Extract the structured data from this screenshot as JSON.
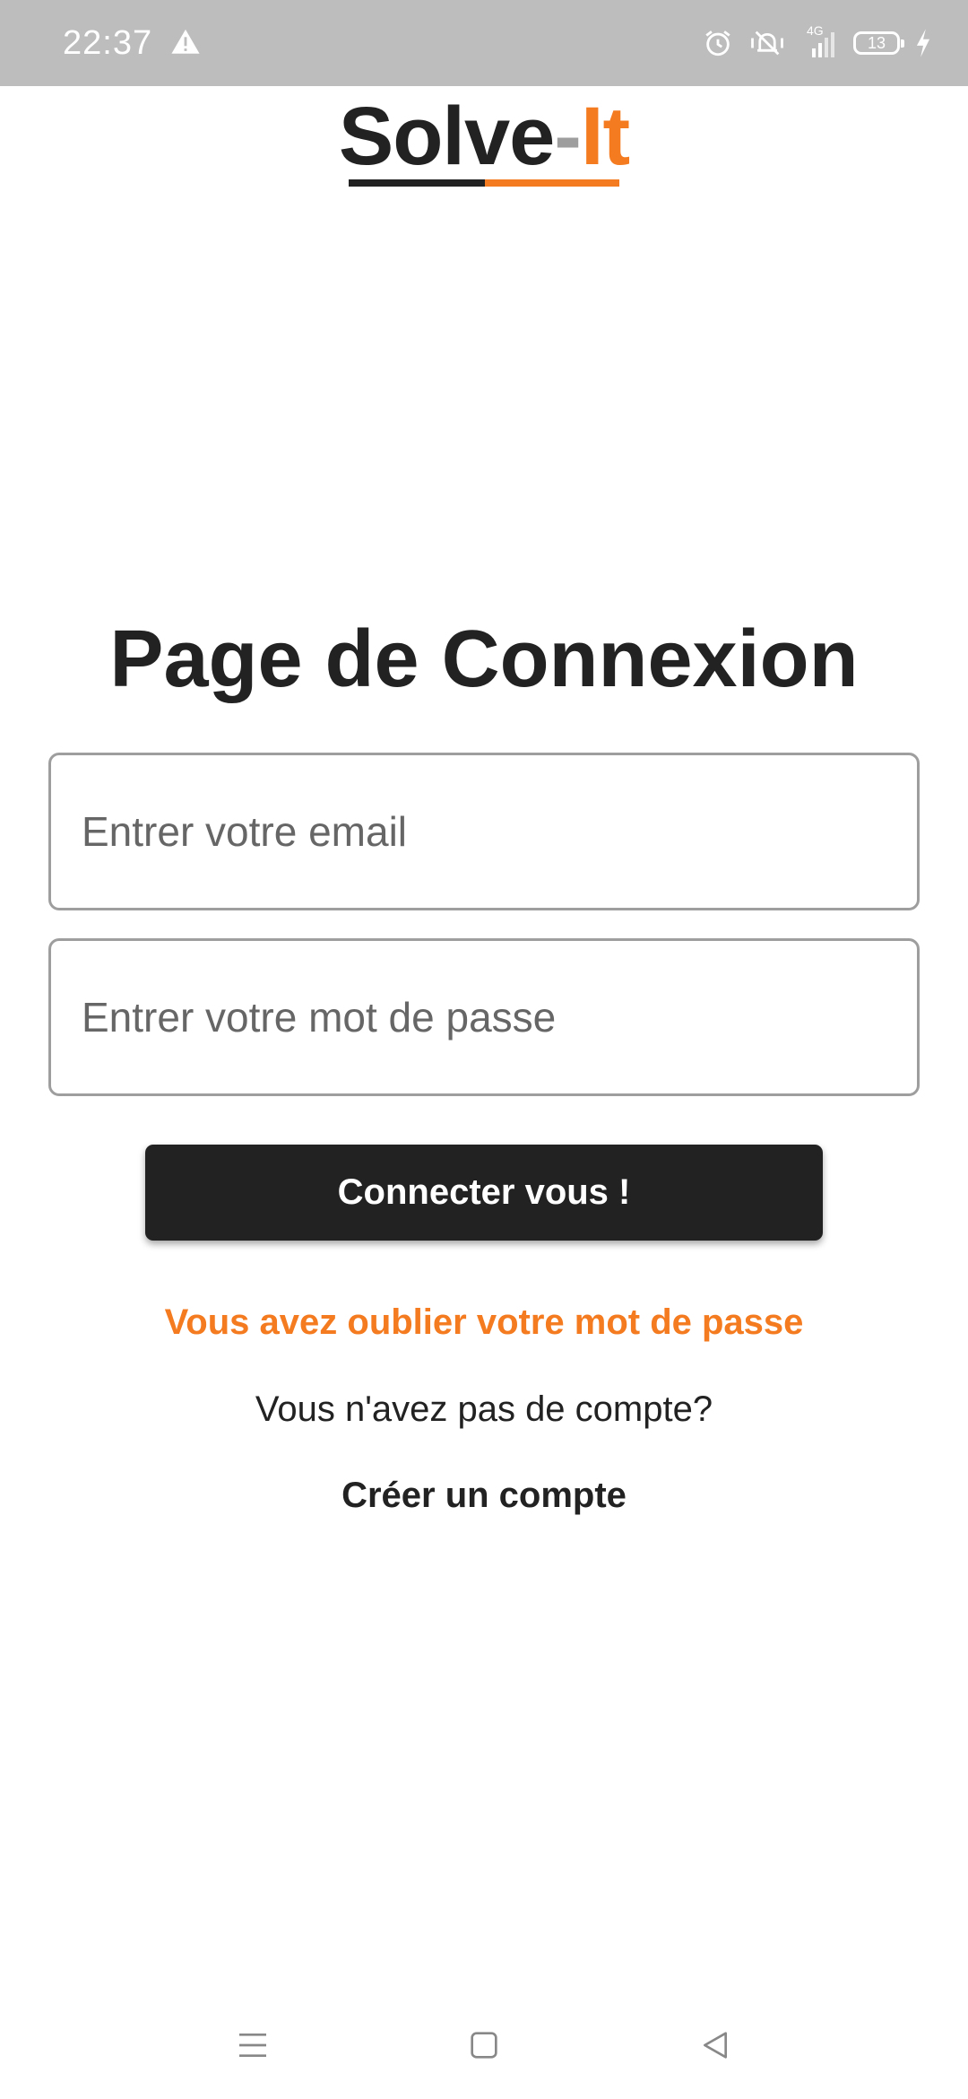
{
  "status_bar": {
    "time": "22:37",
    "network_label": "4G",
    "battery_level": "13",
    "icons": [
      "warning-icon",
      "alarm-icon",
      "vibrate-off-icon",
      "signal-icon",
      "battery-icon",
      "charging-icon"
    ]
  },
  "logo": {
    "main": "Solve",
    "dash": "-",
    "accent": "It"
  },
  "page": {
    "title": "Page de Connexion"
  },
  "form": {
    "email_placeholder": "Entrer votre email",
    "email_value": "",
    "password_placeholder": "Entrer votre mot de passe",
    "password_value": "",
    "login_button": "Connecter vous !"
  },
  "links": {
    "forgot_password": "Vous avez oublier votre mot de passe",
    "no_account": "Vous n'avez pas de compte?",
    "create_account": "Créer un compte"
  },
  "nav": {
    "icons": [
      "menu-icon",
      "home-icon",
      "back-icon"
    ]
  },
  "colors": {
    "accent": "#f47b20",
    "dark": "#222222",
    "status_bar": "#bdbdbd"
  }
}
